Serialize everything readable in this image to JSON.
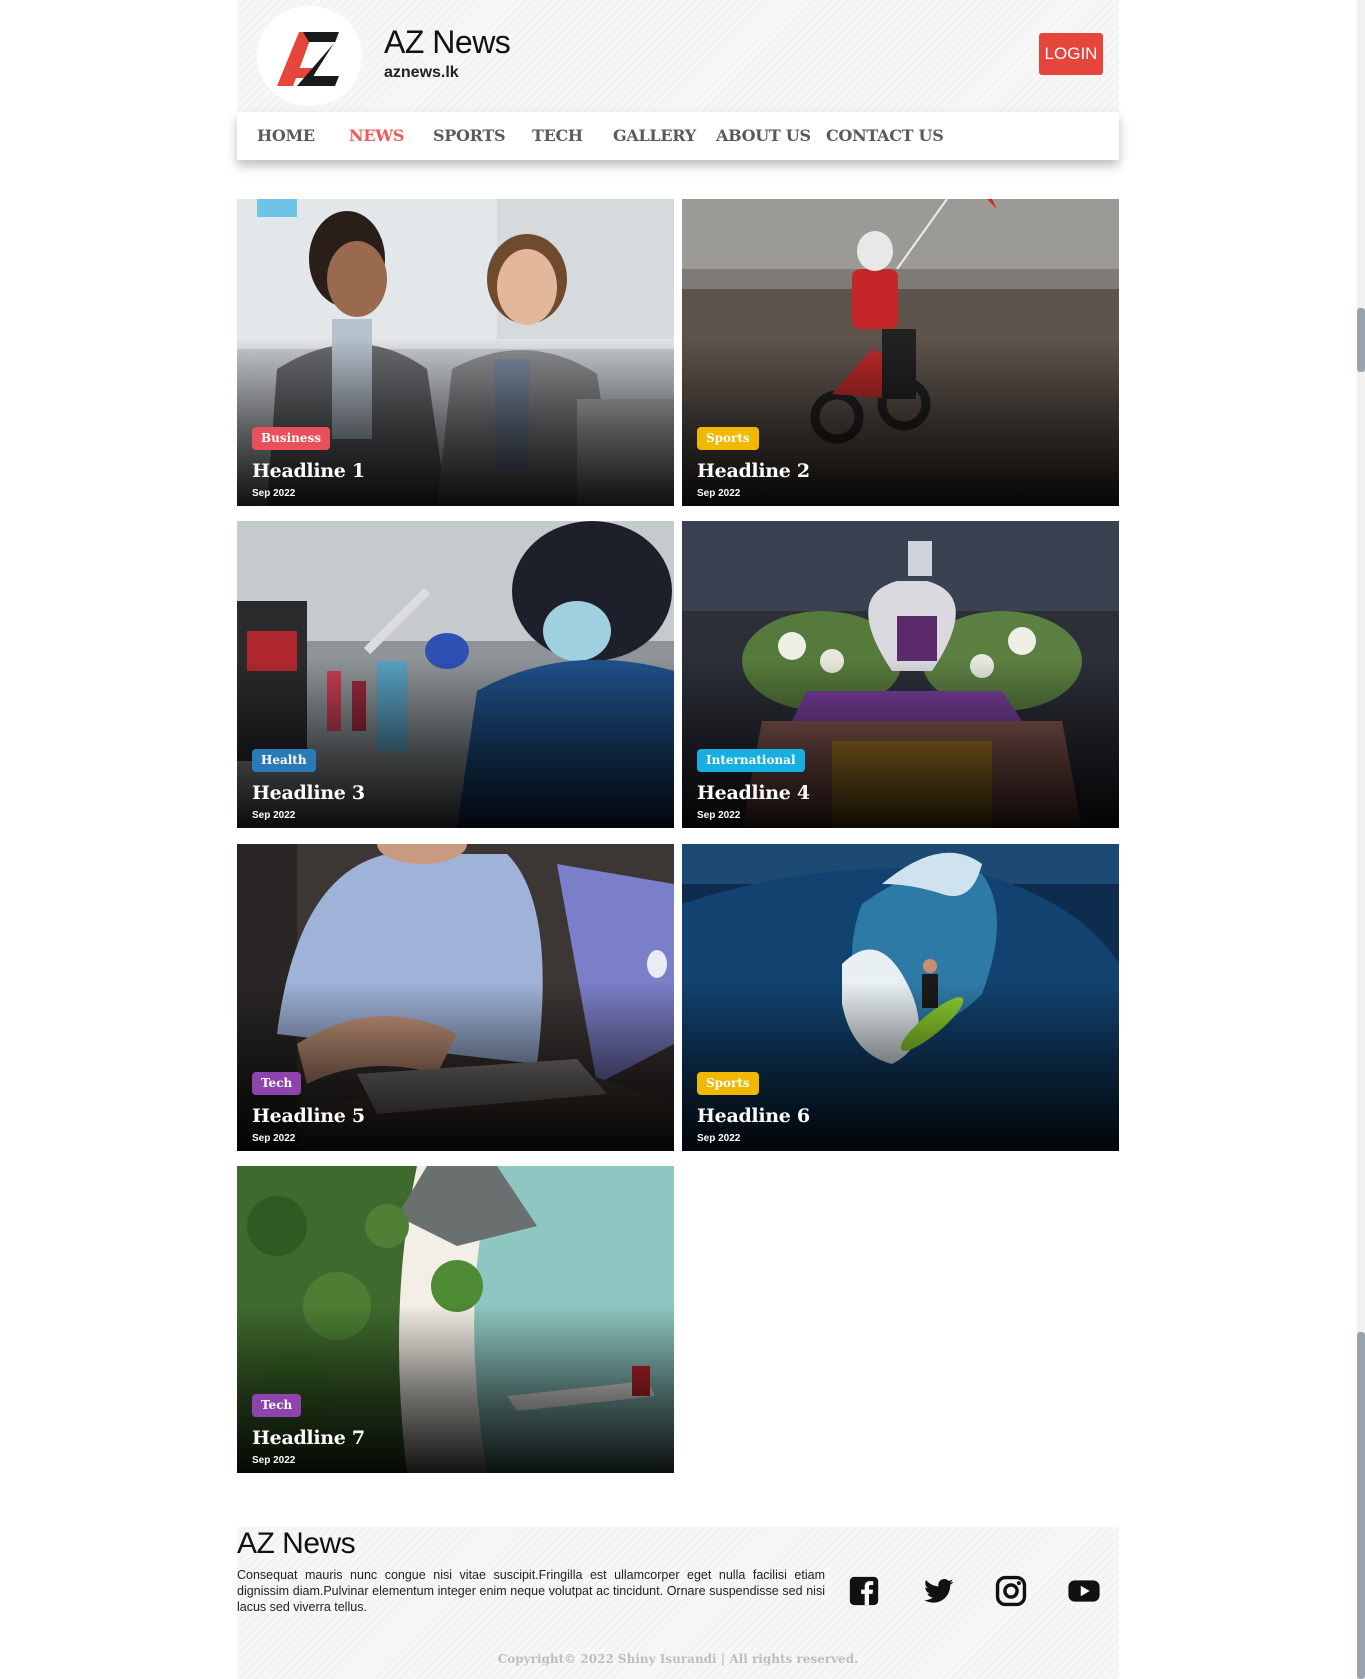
{
  "brand": {
    "title": "AZ News",
    "subtitle": "aznews.lk",
    "colors": {
      "accent": "#e5453a",
      "nav_active": "#f0595a"
    }
  },
  "header": {
    "login_label": "LOGIN"
  },
  "nav": {
    "items": [
      {
        "label": "HOME",
        "active": false
      },
      {
        "label": "NEWS",
        "active": true
      },
      {
        "label": "SPORTS",
        "active": false
      },
      {
        "label": "TECH",
        "active": false
      },
      {
        "label": "GALLERY",
        "active": false
      },
      {
        "label": "ABOUT US",
        "active": false
      },
      {
        "label": "CONTACT US",
        "active": false
      }
    ]
  },
  "cards": [
    {
      "category": "Business",
      "category_color": "#e8505b",
      "headline": "Headline 1",
      "date": "Sep 2022",
      "image": "office-colleagues-photo"
    },
    {
      "category": "Sports",
      "category_color": "#f1b800",
      "headline": "Headline 2",
      "date": "Sep 2022",
      "image": "motocross-beach-photo"
    },
    {
      "category": "Health",
      "category_color": "#2a7ab8",
      "headline": "Headline 3",
      "date": "Sep 2022",
      "image": "lab-scientist-photo"
    },
    {
      "category": "International",
      "category_color": "#17aee0",
      "headline": "Headline 4",
      "date": "Sep 2022",
      "image": "royal-crown-photo"
    },
    {
      "category": "Tech",
      "category_color": "#8e44ad",
      "headline": "Headline 5",
      "date": "Sep 2022",
      "image": "laptop-writing-photo"
    },
    {
      "category": "Sports",
      "category_color": "#f1b800",
      "headline": "Headline 6",
      "date": "Sep 2022",
      "image": "surfer-wave-photo"
    },
    {
      "category": "Tech",
      "category_color": "#8e44ad",
      "headline": "Headline 7",
      "date": "Sep 2022",
      "image": "tropical-island-aerial-photo"
    }
  ],
  "footer": {
    "title": "AZ News",
    "description": "Consequat mauris nunc congue nisi vitae suscipit.Fringilla est ullamcorper eget nulla facilisi etiam dignissim diam.Pulvinar elementum integer enim neque volutpat ac tincidunt. Ornare suspendisse sed nisi lacus sed viverra tellus.",
    "social": [
      "facebook-icon",
      "twitter-icon",
      "instagram-icon",
      "youtube-icon"
    ],
    "copyright": "Copyright© 2022 Shiny Isurandi | All rights reserved."
  }
}
